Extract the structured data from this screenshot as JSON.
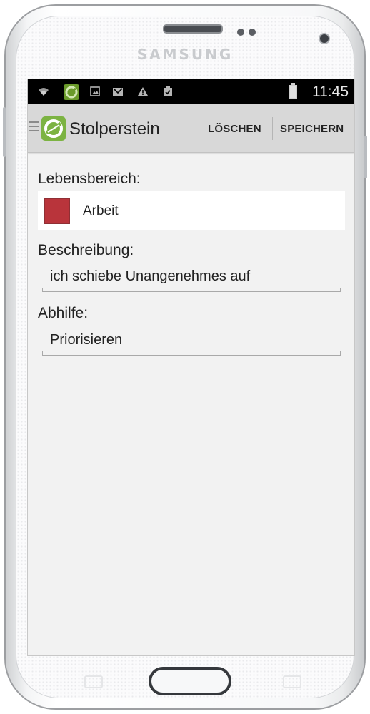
{
  "device": {
    "brand": "SAMSUNG"
  },
  "status_bar": {
    "time": "11:45"
  },
  "action_bar": {
    "title": "Stolperstein",
    "delete_label": "LÖSCHEN",
    "save_label": "SPEICHERN"
  },
  "form": {
    "area_label": "Lebensbereich:",
    "area_value": "Arbeit",
    "area_color": "#b9343b",
    "description_label": "Beschreibung:",
    "description_value": "ich schiebe Unangenehmes auf",
    "remedy_label": "Abhilfe:",
    "remedy_value": "Priorisieren"
  },
  "colors": {
    "logo_green": "#7cb342",
    "statusbar": "#000000",
    "actionbar": "#d8d8d8"
  }
}
